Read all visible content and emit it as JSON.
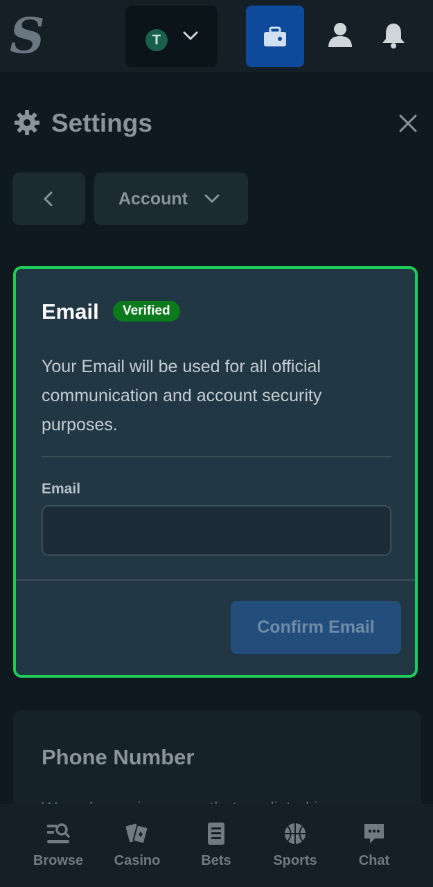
{
  "header": {
    "logo_text": "S",
    "currency_coin_symbol": "T",
    "colors": {
      "wallet_button": "#0e4a99",
      "tether_coin": "#1a5f4a"
    }
  },
  "icons": {
    "currency_dropdown": "chevron-down-icon",
    "wallet": "wallet-icon",
    "user": "user-icon",
    "notifications": "bell-icon",
    "settings": "gear-icon",
    "close": "close-icon",
    "back": "chevron-left-icon"
  },
  "settings": {
    "title": "Settings",
    "section_dropdown": "Account"
  },
  "email_card": {
    "heading": "Email",
    "badge": "Verified",
    "description": "Your Email will be used for all official communication and account security purposes.",
    "field_label": "Email",
    "field_value": "",
    "confirm_button": "Confirm Email",
    "colors": {
      "highlight_border": "#1fcb58",
      "badge": "#0a7a1c"
    }
  },
  "phone_card": {
    "heading": "Phone Number",
    "description_partial": "We only service areas that are listed in"
  },
  "bottom_nav": {
    "items": [
      {
        "label": "Browse",
        "icon": "browse-search-icon"
      },
      {
        "label": "Casino",
        "icon": "cards-icon"
      },
      {
        "label": "Bets",
        "icon": "bet-slip-icon"
      },
      {
        "label": "Sports",
        "icon": "basketball-icon"
      },
      {
        "label": "Chat",
        "icon": "chat-bubble-icon"
      }
    ]
  }
}
